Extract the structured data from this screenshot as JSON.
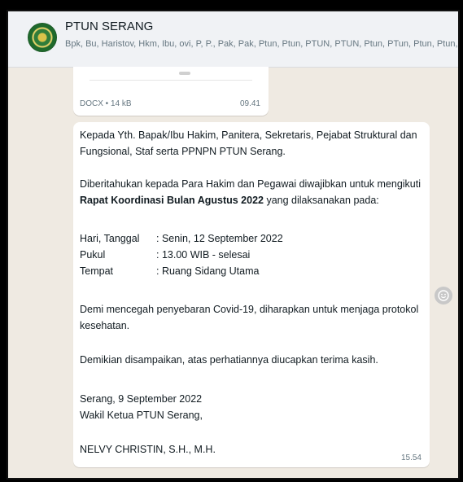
{
  "chat": {
    "title": "PTUN SERANG",
    "members": "Bpk, Bu, Haristov, Hkm, Ibu, ovi, P, P., Pak, Pak, Ptun, Ptun, PTUN, PTUN, Ptun, PTun, Ptun, Ptun, Ptun, Ptun, Ptun, P"
  },
  "document": {
    "meta": "DOCX • 14 kB",
    "time": "09.41"
  },
  "message": {
    "greeting": "Kepada Yth. Bapak/Ibu Hakim, Panitera, Sekretaris, Pejabat Struktural dan Fungsional, Staf serta PPNPN PTUN Serang.",
    "intro_pre": "Diberitahukan kepada Para Hakim dan Pegawai diwajibkan untuk mengikuti ",
    "intro_bold": "Rapat Koordinasi Bulan Agustus 2022",
    "intro_post": " yang dilaksanakan pada:",
    "day_label": "Hari, Tanggal",
    "day_value": ": Senin, 12 September 2022",
    "time_label": "Pukul",
    "time_value": ": 13.00 WIB - selesai",
    "place_label": "Tempat",
    "place_value": ": Ruang Sidang Utama",
    "health": "Demi mencegah penyebaran Covid-19, diharapkan untuk menjaga protokol kesehatan.",
    "closing": "Demikian disampaikan, atas perhatiannya diucapkan terima kasih.",
    "place_date": "Serang, 9 September 2022",
    "signer_title": "Wakil Ketua PTUN Serang,",
    "signer_name": "NELVY CHRISTIN, S.H., M.H.",
    "time": "15.54"
  }
}
